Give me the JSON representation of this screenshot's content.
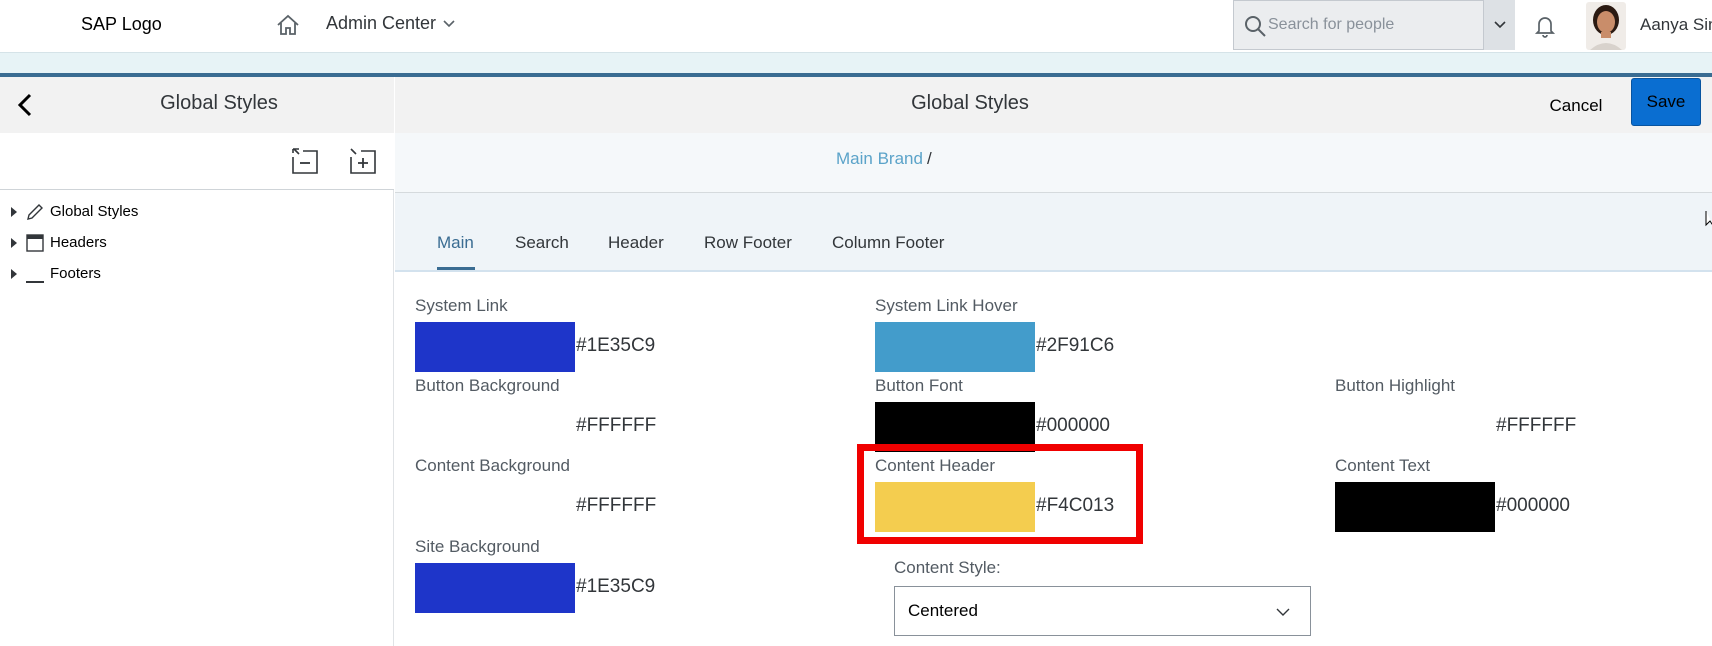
{
  "shell": {
    "logo": "SAP Logo",
    "nav_title": "Admin Center",
    "search_placeholder": "Search for people",
    "user_name": "Aanya Sin"
  },
  "left_panel": {
    "title": "Global Styles",
    "tree": [
      {
        "label": "Global Styles",
        "icon": "pencil-icon"
      },
      {
        "label": "Headers",
        "icon": "window-icon"
      },
      {
        "label": "Footers",
        "icon": "underline-icon"
      }
    ]
  },
  "editor": {
    "title": "Global Styles",
    "cancel_label": "Cancel",
    "save_label": "Save",
    "breadcrumb": {
      "link": "Main Brand",
      "separator": "/"
    },
    "tabs": [
      "Main",
      "Search",
      "Header",
      "Row Footer",
      "Column Footer"
    ],
    "active_tab": "Main",
    "fields": {
      "system_link": {
        "label": "System Link",
        "hex": "#1E35C9",
        "color": "#1E35C9"
      },
      "system_link_hover": {
        "label": "System Link Hover",
        "hex": "#2F91C6",
        "color": "#439CCB"
      },
      "button_background": {
        "label": "Button Background",
        "hex": "#FFFFFF",
        "color": "#FFFFFF"
      },
      "button_font": {
        "label": "Button Font",
        "hex": "#000000",
        "color": "#000000"
      },
      "button_highlight": {
        "label": "Button Highlight",
        "hex": "#FFFFFF",
        "color": "#FFFFFF"
      },
      "content_background": {
        "label": "Content Background",
        "hex": "#FFFFFF",
        "color": "#FFFFFF"
      },
      "content_header": {
        "label": "Content Header",
        "hex": "#F4C013",
        "color": "#F4CD4F"
      },
      "content_text": {
        "label": "Content Text",
        "hex": "#000000",
        "color": "#000000"
      },
      "site_background": {
        "label": "Site Background",
        "hex": "#1E35C9",
        "color": "#1E35C9"
      }
    },
    "content_style": {
      "label": "Content Style:",
      "value": "Centered"
    }
  }
}
